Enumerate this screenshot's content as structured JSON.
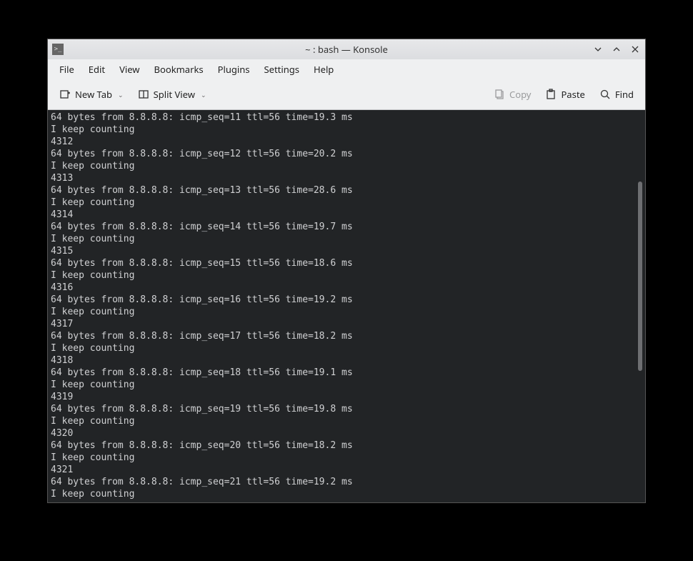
{
  "window": {
    "title": "~ : bash — Konsole"
  },
  "menubar": {
    "items": [
      "File",
      "Edit",
      "View",
      "Bookmarks",
      "Plugins",
      "Settings",
      "Help"
    ]
  },
  "toolbar": {
    "new_tab": "New Tab",
    "split_view": "Split View",
    "copy": "Copy",
    "paste": "Paste",
    "find": "Find"
  },
  "terminal": {
    "lines": [
      "64 bytes from 8.8.8.8: icmp_seq=11 ttl=56 time=19.3 ms",
      "I keep counting",
      "4312",
      "64 bytes from 8.8.8.8: icmp_seq=12 ttl=56 time=20.2 ms",
      "I keep counting",
      "4313",
      "64 bytes from 8.8.8.8: icmp_seq=13 ttl=56 time=28.6 ms",
      "I keep counting",
      "4314",
      "64 bytes from 8.8.8.8: icmp_seq=14 ttl=56 time=19.7 ms",
      "I keep counting",
      "4315",
      "64 bytes from 8.8.8.8: icmp_seq=15 ttl=56 time=18.6 ms",
      "I keep counting",
      "4316",
      "64 bytes from 8.8.8.8: icmp_seq=16 ttl=56 time=19.2 ms",
      "I keep counting",
      "4317",
      "64 bytes from 8.8.8.8: icmp_seq=17 ttl=56 time=18.2 ms",
      "I keep counting",
      "4318",
      "64 bytes from 8.8.8.8: icmp_seq=18 ttl=56 time=19.1 ms",
      "I keep counting",
      "4319",
      "64 bytes from 8.8.8.8: icmp_seq=19 ttl=56 time=19.8 ms",
      "I keep counting",
      "4320",
      "64 bytes from 8.8.8.8: icmp_seq=20 ttl=56 time=18.2 ms",
      "I keep counting",
      "4321",
      "64 bytes from 8.8.8.8: icmp_seq=21 ttl=56 time=19.2 ms",
      "I keep counting"
    ]
  }
}
